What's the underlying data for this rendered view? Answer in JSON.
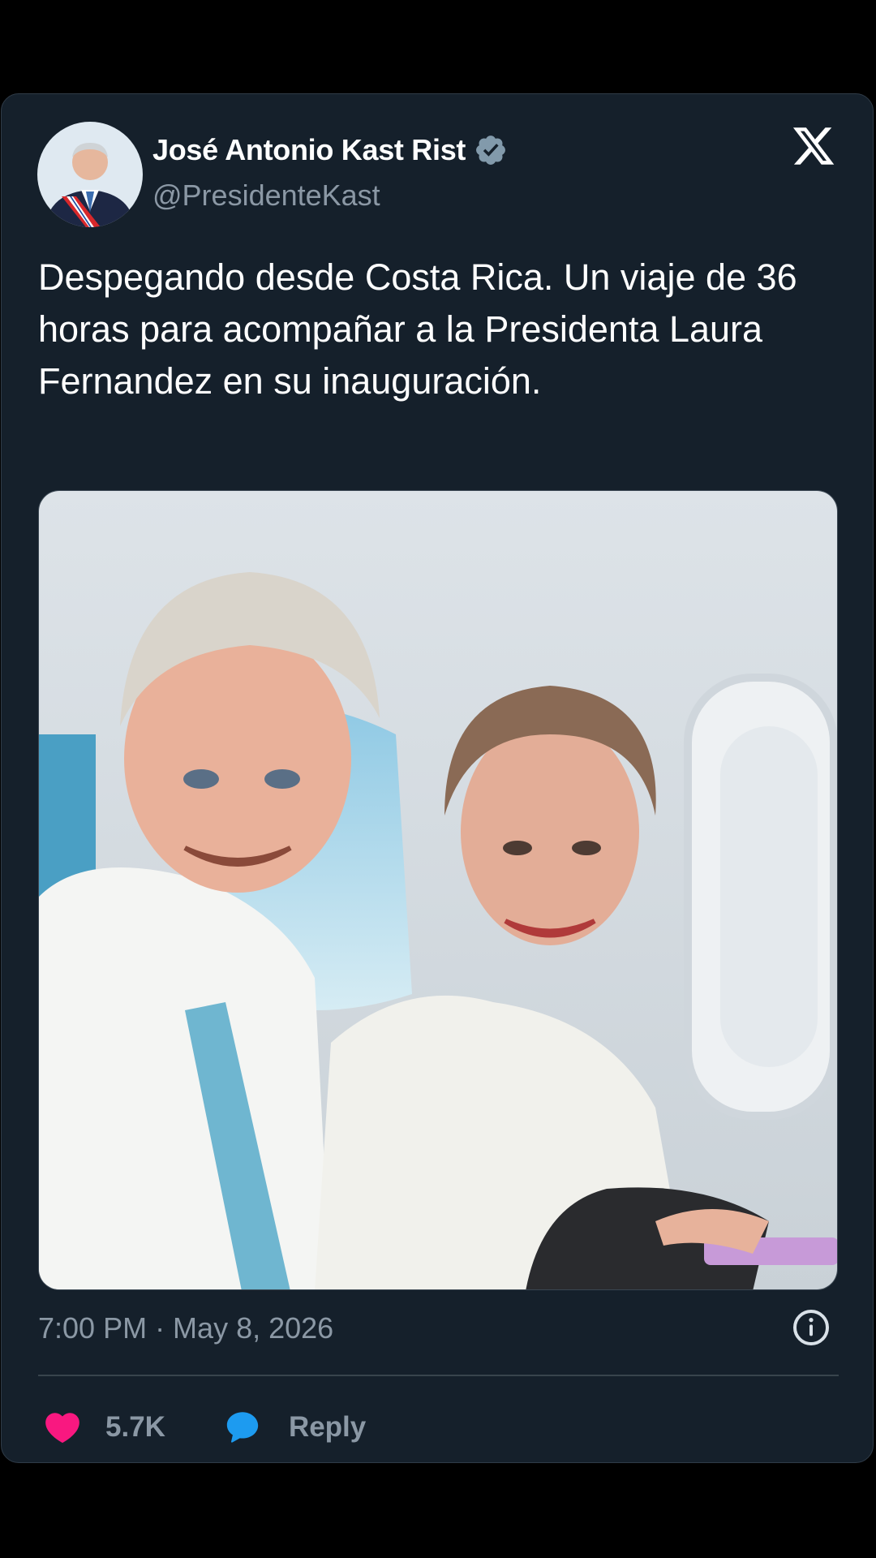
{
  "tweet": {
    "author_name": "José Antonio Kast Rist",
    "author_handle": "@PresidenteKast",
    "text": "Despegando desde Costa Rica. Un viaje de 36 horas para acompañar a la Presidenta Laura Fernandez en su inauguración.",
    "timestamp": "7:00 PM · May 8, 2026",
    "media_description": "Selfie of two smiling people seated inside an airplane next to a window",
    "likes_count": "5.7K",
    "reply_label": "Reply"
  },
  "icons": {
    "verified": "verified-badge-icon",
    "brand": "x-logo-icon",
    "info": "info-icon",
    "like": "heart-icon",
    "reply": "speech-bubble-icon"
  },
  "colors": {
    "background": "#000000",
    "card": "#15202b",
    "text_primary": "#ffffff",
    "text_secondary": "#8b98a5",
    "heart": "#f91880",
    "reply_bubble": "#1d9bf0",
    "verified_badge": "#829aab",
    "divider": "#38444d"
  }
}
